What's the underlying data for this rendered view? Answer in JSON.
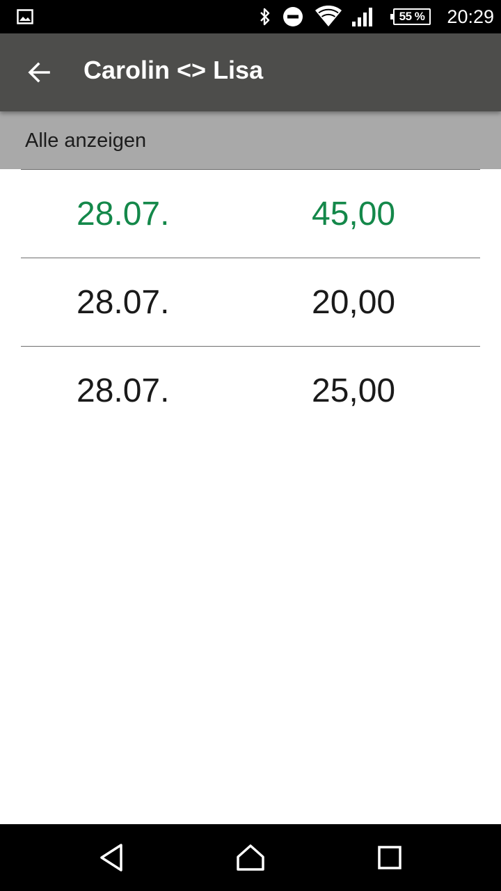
{
  "status_bar": {
    "icons": [
      "gallery-icon",
      "bluetooth-icon",
      "do-not-disturb-icon",
      "wifi-icon",
      "signal-icon",
      "battery-icon"
    ],
    "battery": "55 %",
    "time": "20:29"
  },
  "app_bar": {
    "back_icon": "arrow-back-icon",
    "title": "Carolin <> Lisa"
  },
  "filter": {
    "label": "Alle anzeigen"
  },
  "rows": [
    {
      "date": "28.07.",
      "amount": "45,00",
      "highlight": true
    },
    {
      "date": "28.07.",
      "amount": "20,00",
      "highlight": false
    },
    {
      "date": "28.07.",
      "amount": "25,00",
      "highlight": false
    }
  ],
  "nav_bar": {
    "icons": [
      "back-triangle-icon",
      "home-icon",
      "recents-icon"
    ]
  },
  "colors": {
    "app_bar": "#4d4d4b",
    "filter_bar": "#a9a9a9",
    "highlight_text": "#14884a",
    "text": "#1a1a1a"
  }
}
